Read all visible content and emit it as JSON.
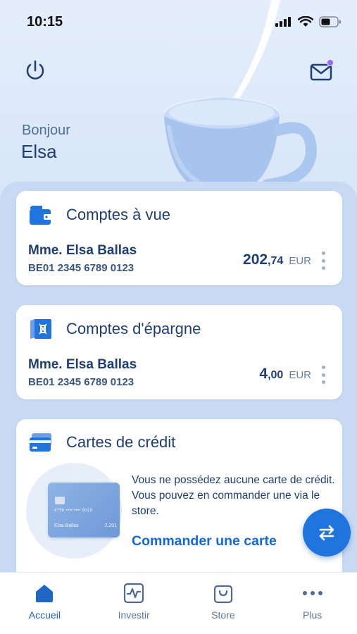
{
  "status_bar": {
    "time": "10:15"
  },
  "greeting": {
    "hello": "Bonjour",
    "name": "Elsa"
  },
  "accounts": [
    {
      "section_title": "Comptes à vue",
      "holder": "Mme. Elsa Ballas",
      "iban": "BE01 2345 6789 0123",
      "amount_int": "202",
      "amount_dec": ",74",
      "currency": "EUR"
    },
    {
      "section_title": "Comptes d'épargne",
      "holder": "Mme. Elsa Ballas",
      "iban": "BE01 2345 6789 0123",
      "amount_int": "4",
      "amount_dec": ",00",
      "currency": "EUR"
    }
  ],
  "credit_cards": {
    "section_title": "Cartes de crédit",
    "message": "Vous ne possédez aucune carte de crédit. Vous pouvez en commander une via le store.",
    "cta": "Commander une carte",
    "card_visual": {
      "number": "4756 •••• •••• 9018",
      "holder": "Elsa Ballas",
      "valid": "2.201"
    }
  },
  "tabbar": {
    "items": [
      {
        "label": "Accueil",
        "icon": "home-icon",
        "active": true
      },
      {
        "label": "Investir",
        "icon": "chart-pulse-icon",
        "active": false
      },
      {
        "label": "Store",
        "icon": "shopping-bag-icon",
        "active": false
      },
      {
        "label": "Plus",
        "icon": "more-dots-icon",
        "active": false
      }
    ]
  },
  "colors": {
    "primary": "#1f74dd",
    "navy": "#1f3e72",
    "notification": "#9b66f2"
  }
}
